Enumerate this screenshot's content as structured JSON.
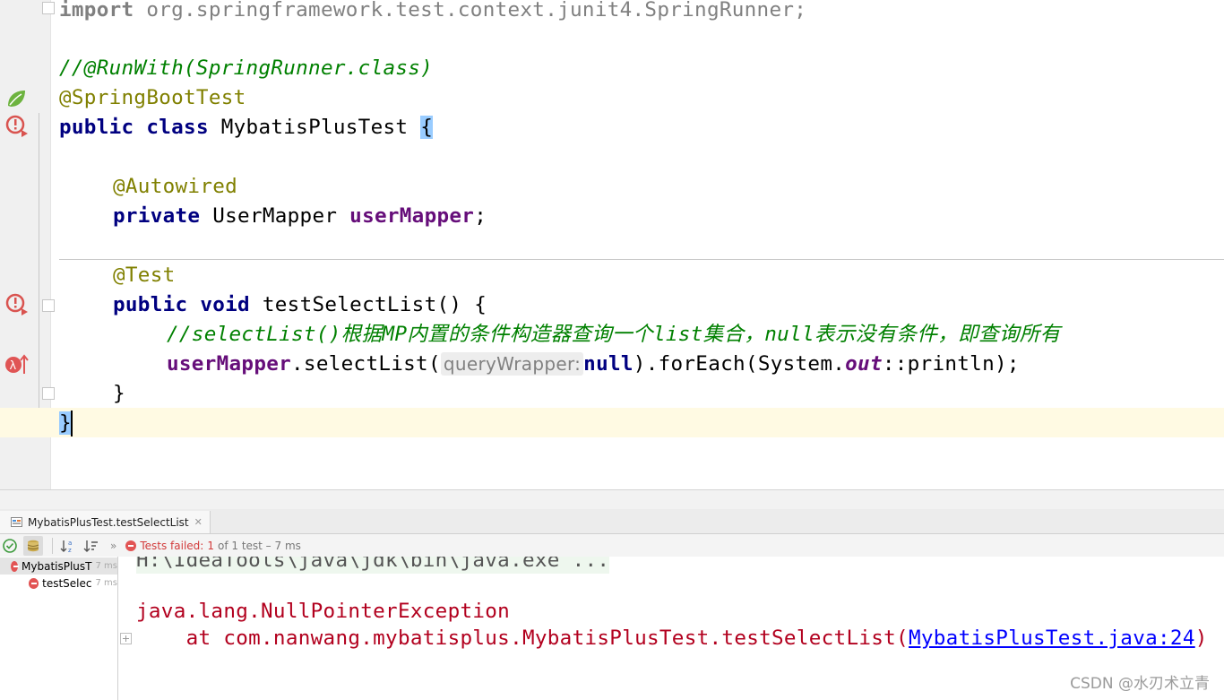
{
  "editor": {
    "lines": {
      "import_kw": "import",
      "import_pkg": " org.springframework.test.context.junit4.SpringRunner;",
      "runwith_comment": "//@RunWith(SpringRunner.class)",
      "springboot_ann": "@SpringBootTest",
      "class_public": "public",
      "class_kw": "class",
      "class_name": " MybatisPlusTest ",
      "class_brace": "{",
      "autowired_ann": "@Autowired",
      "private_kw": "private",
      "mapper_type": " UserMapper ",
      "mapper_field": "userMapper",
      "semicolon": ";",
      "test_ann": "@Test",
      "method_public": "public",
      "method_void": "void",
      "method_sig": " testSelectList() {",
      "chinese_comment": "//selectList()根据MP内置的条件构造器查询一个list集合，null表示没有条件，即查询所有",
      "call_field": "userMapper",
      "call_select": ".selectList(",
      "param_hint": "queryWrapper:",
      "null_kw": "null",
      "call_foreach": ").forEach(System.",
      "out_field": "out",
      "call_println": "::println);",
      "method_close": "}",
      "class_close": "}"
    }
  },
  "run_panel": {
    "tab_label": "MybatisPlusTest.testSelectList",
    "status_label": "Tests failed:",
    "failed_count": "1",
    "status_rest": "of 1 test – 7 ms",
    "tree": [
      {
        "label": "MybatisPlusT",
        "time": "7 ms"
      },
      {
        "label": "testSelec",
        "time": "7 ms"
      }
    ],
    "console": {
      "command": "H:\\IdeaTools\\java\\jdk\\bin\\java.exe ...",
      "exception": "java.lang.NullPointerException",
      "at_prefix": "    at com.nanwang.mybatisplus.MybatisPlusTest.testSelectList(",
      "link": "MybatisPlusTest.java:24",
      "close": ")"
    }
  },
  "watermark": "CSDN @水刃术立青"
}
